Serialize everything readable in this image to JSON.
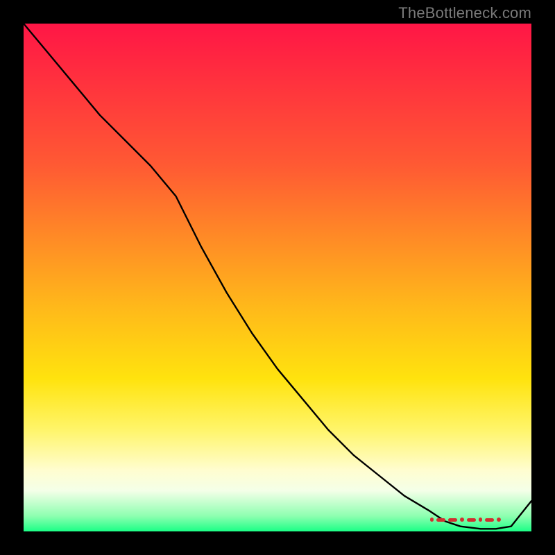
{
  "watermark": "TheBottleneck.com",
  "colors": {
    "frame": "#000000",
    "line": "#000000",
    "watermark": "#7a7a7a",
    "valley_marker": "#d03030",
    "gradient_stops": [
      "#ff1646",
      "#ff2940",
      "#ff5a33",
      "#ff8a26",
      "#ffb91a",
      "#ffe30e",
      "#fff56a",
      "#fffdd0",
      "#f4ffe8",
      "#8dffb0",
      "#1bff86"
    ]
  },
  "chart_data": {
    "type": "line",
    "title": "",
    "xlabel": "",
    "ylabel": "",
    "x": [
      0.0,
      0.05,
      0.1,
      0.15,
      0.2,
      0.25,
      0.3,
      0.35,
      0.4,
      0.45,
      0.5,
      0.55,
      0.6,
      0.65,
      0.7,
      0.75,
      0.8,
      0.83,
      0.86,
      0.9,
      0.93,
      0.96,
      1.0
    ],
    "values": [
      1.0,
      0.94,
      0.88,
      0.82,
      0.77,
      0.72,
      0.66,
      0.56,
      0.47,
      0.39,
      0.32,
      0.26,
      0.2,
      0.15,
      0.11,
      0.07,
      0.04,
      0.02,
      0.01,
      0.005,
      0.005,
      0.01,
      0.06
    ],
    "xlim": [
      0,
      1
    ],
    "ylim": [
      0,
      1
    ],
    "notes": "Axis-less bottleneck curve; x ≈ normalized hardware balance, y ≈ bottleneck severity (red=high, green=optimal). No tick labels rendered in source image — values above are read off relative position of the black polyline inside the gradient box.",
    "valley_marker": {
      "x_start": 0.8,
      "x_end": 0.94,
      "y": 0.02,
      "style": "red rounded dashes"
    }
  }
}
